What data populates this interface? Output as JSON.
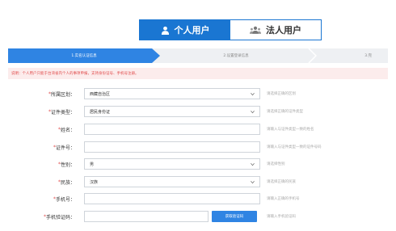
{
  "tabs": [
    {
      "label": "个人用户",
      "icon": "person-icon",
      "active": true
    },
    {
      "label": "法人用户",
      "icon": "people-group-icon",
      "active": false
    }
  ],
  "steps": [
    {
      "label": "1.实名认证信息"
    },
    {
      "label": "2.设置登录信息"
    },
    {
      "label": "3.完"
    }
  ],
  "notice": "说明：个人用户只能于台湾省内个人的事项申报，支持身份证号、手机号注册。",
  "form": {
    "region": {
      "label": "所属区划：",
      "value": "西藏自治区",
      "hint": "请选择正确的区划"
    },
    "id_type": {
      "label": "证件类型：",
      "value": "居民身份证",
      "hint": "请选择正确的证件类型"
    },
    "name": {
      "label": "姓名：",
      "value": "",
      "hint": "请输入与证件类型一致的姓名"
    },
    "id_number": {
      "label": "证件号：",
      "value": "",
      "hint": "请输入与证件类型一致的证件号码"
    },
    "gender": {
      "label": "性别：",
      "value": "男",
      "hint": "请选择性别"
    },
    "ethnicity": {
      "label": "民族：",
      "value": "汉族",
      "hint": "请选择正确的民族"
    },
    "phone": {
      "label": "手机号：",
      "value": "",
      "hint": "请输入正确的手机号"
    },
    "sms_code": {
      "label": "手机验证码：",
      "value": "",
      "button": "获取验证码",
      "hint": "请输入手机验证码"
    }
  },
  "colors": {
    "primary": "#1a76d2",
    "step_active": "#2f84e3",
    "error": "#e04c4c",
    "notice_bg": "#fcecec"
  }
}
